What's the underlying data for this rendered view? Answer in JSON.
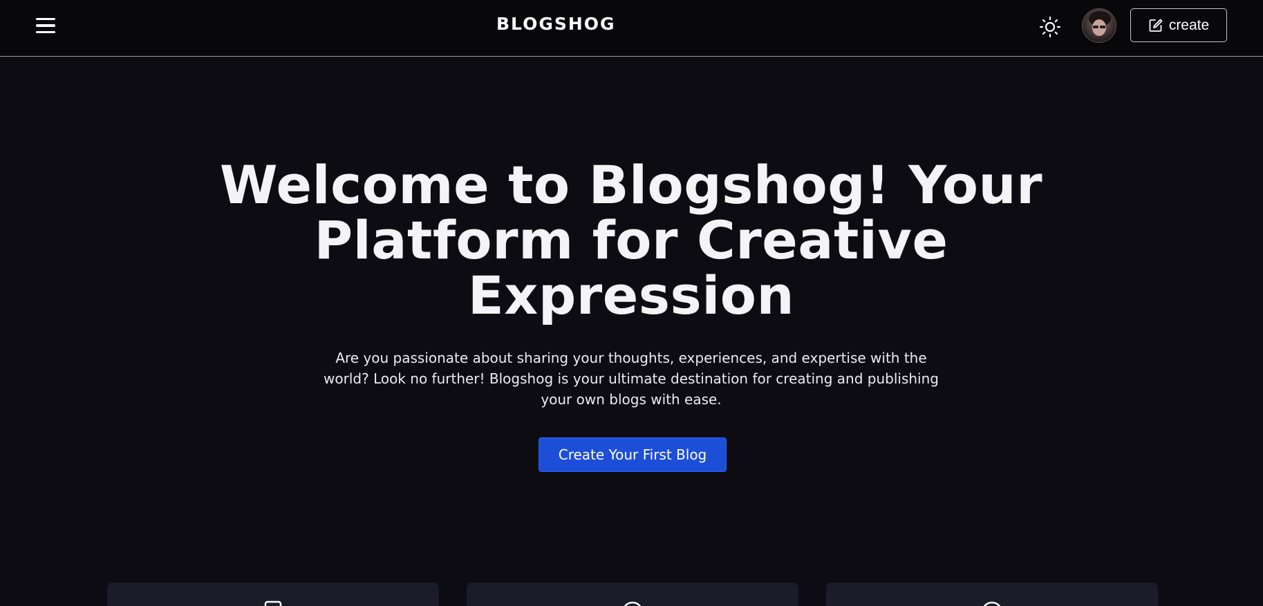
{
  "navbar": {
    "brand": "BLOGSHOG",
    "create_label": "create"
  },
  "hero": {
    "title": "Welcome to Blogshog! Your Platform for Creative Expression",
    "description": "Are you passionate about sharing your thoughts, experiences, and expertise with the world? Look no further! Blogshog is your ultimate destination for creating and publishing your own blogs with ease.",
    "cta_label": "Create Your First Blog"
  },
  "icons": {
    "menu": "hamburger-menu-icon",
    "theme": "sun-icon",
    "create": "edit-square-icon"
  },
  "colors": {
    "background": "#0c0c12",
    "navbar": "#08080a",
    "accent": "#1d4ed8",
    "card": "#1b1c2a"
  }
}
